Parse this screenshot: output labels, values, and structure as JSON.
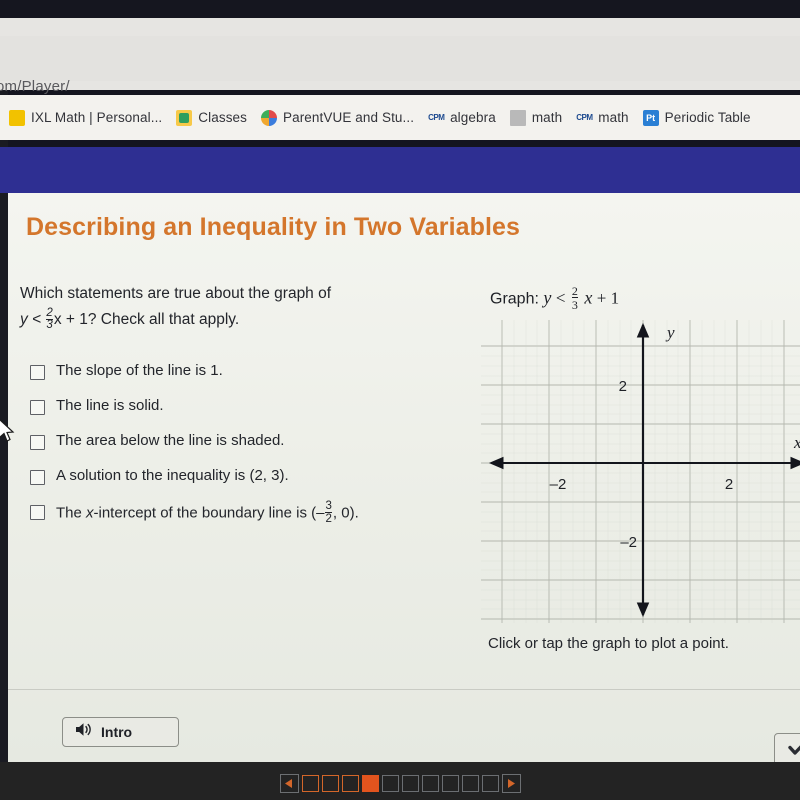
{
  "browser": {
    "url_fragment": "om/Player/",
    "bookmarks": [
      {
        "label": "IXL Math | Personal...",
        "icon": "ixl-icon"
      },
      {
        "label": "Classes",
        "icon": "classes-icon"
      },
      {
        "label": "ParentVUE and Stu...",
        "icon": "parentvue-icon"
      },
      {
        "label": "algebra",
        "icon": "cpm-icon"
      },
      {
        "label": "math",
        "icon": "math-icon"
      },
      {
        "label": "math",
        "icon": "cpm-icon"
      },
      {
        "label": "Periodic Table",
        "icon": "periodic-table-icon"
      }
    ],
    "banner_color": "#2e2f92"
  },
  "lesson": {
    "title": "Describing an Inequality in Two Variables",
    "title_color": "#d4762c",
    "question_line1": "Which statements are true about the graph of",
    "question_expr_prefix": "y <",
    "question_frac_num": "2",
    "question_frac_den": "3",
    "question_expr_suffix": "x + 1? Check all that apply.",
    "options": [
      {
        "label": "The slope of the line is 1.",
        "checked": false
      },
      {
        "label": "The line is solid.",
        "checked": false
      },
      {
        "label": "The area below the line is shaded.",
        "checked": false
      },
      {
        "label": "A solution to the inequality is (2, 3).",
        "checked": false
      },
      {
        "label_pre": "The ",
        "label_var": "x",
        "label_mid": "-intercept of the boundary line is (–",
        "frac_num": "3",
        "frac_den": "2",
        "label_post": ", 0).",
        "checked": false
      }
    ],
    "graph_label_prefix": "Graph:",
    "graph_label_y": "y",
    "graph_label_op": "<",
    "graph_frac_num": "2",
    "graph_frac_den": "3",
    "graph_label_x": "x",
    "graph_label_plus": "+ 1",
    "graph_caption": "Click or tap the graph to plot a point.",
    "intro_button": "Intro"
  },
  "chart_data": {
    "type": "scatter",
    "title": "Graph: y < 2/3 x + 1",
    "xlabel": "x",
    "ylabel": "y",
    "xlim": [
      -4.2,
      4.3
    ],
    "ylim": [
      -3.4,
      3.5
    ],
    "xticks": [
      -2,
      2
    ],
    "yticks": [
      2,
      -2
    ],
    "xtick_labels": [
      "–2",
      "2"
    ],
    "ytick_labels": [
      "2",
      "–2"
    ],
    "grid": true,
    "grid_spacing": 1,
    "axis_arrows": true,
    "series": [],
    "annotations": []
  },
  "taskbar": {
    "prev_label": "◀",
    "next_label": "▶",
    "cells": [
      "done",
      "done",
      "done",
      "current",
      "todo",
      "todo",
      "todo",
      "todo",
      "todo",
      "todo"
    ],
    "current_index": 4,
    "accent": "#e2541e"
  }
}
